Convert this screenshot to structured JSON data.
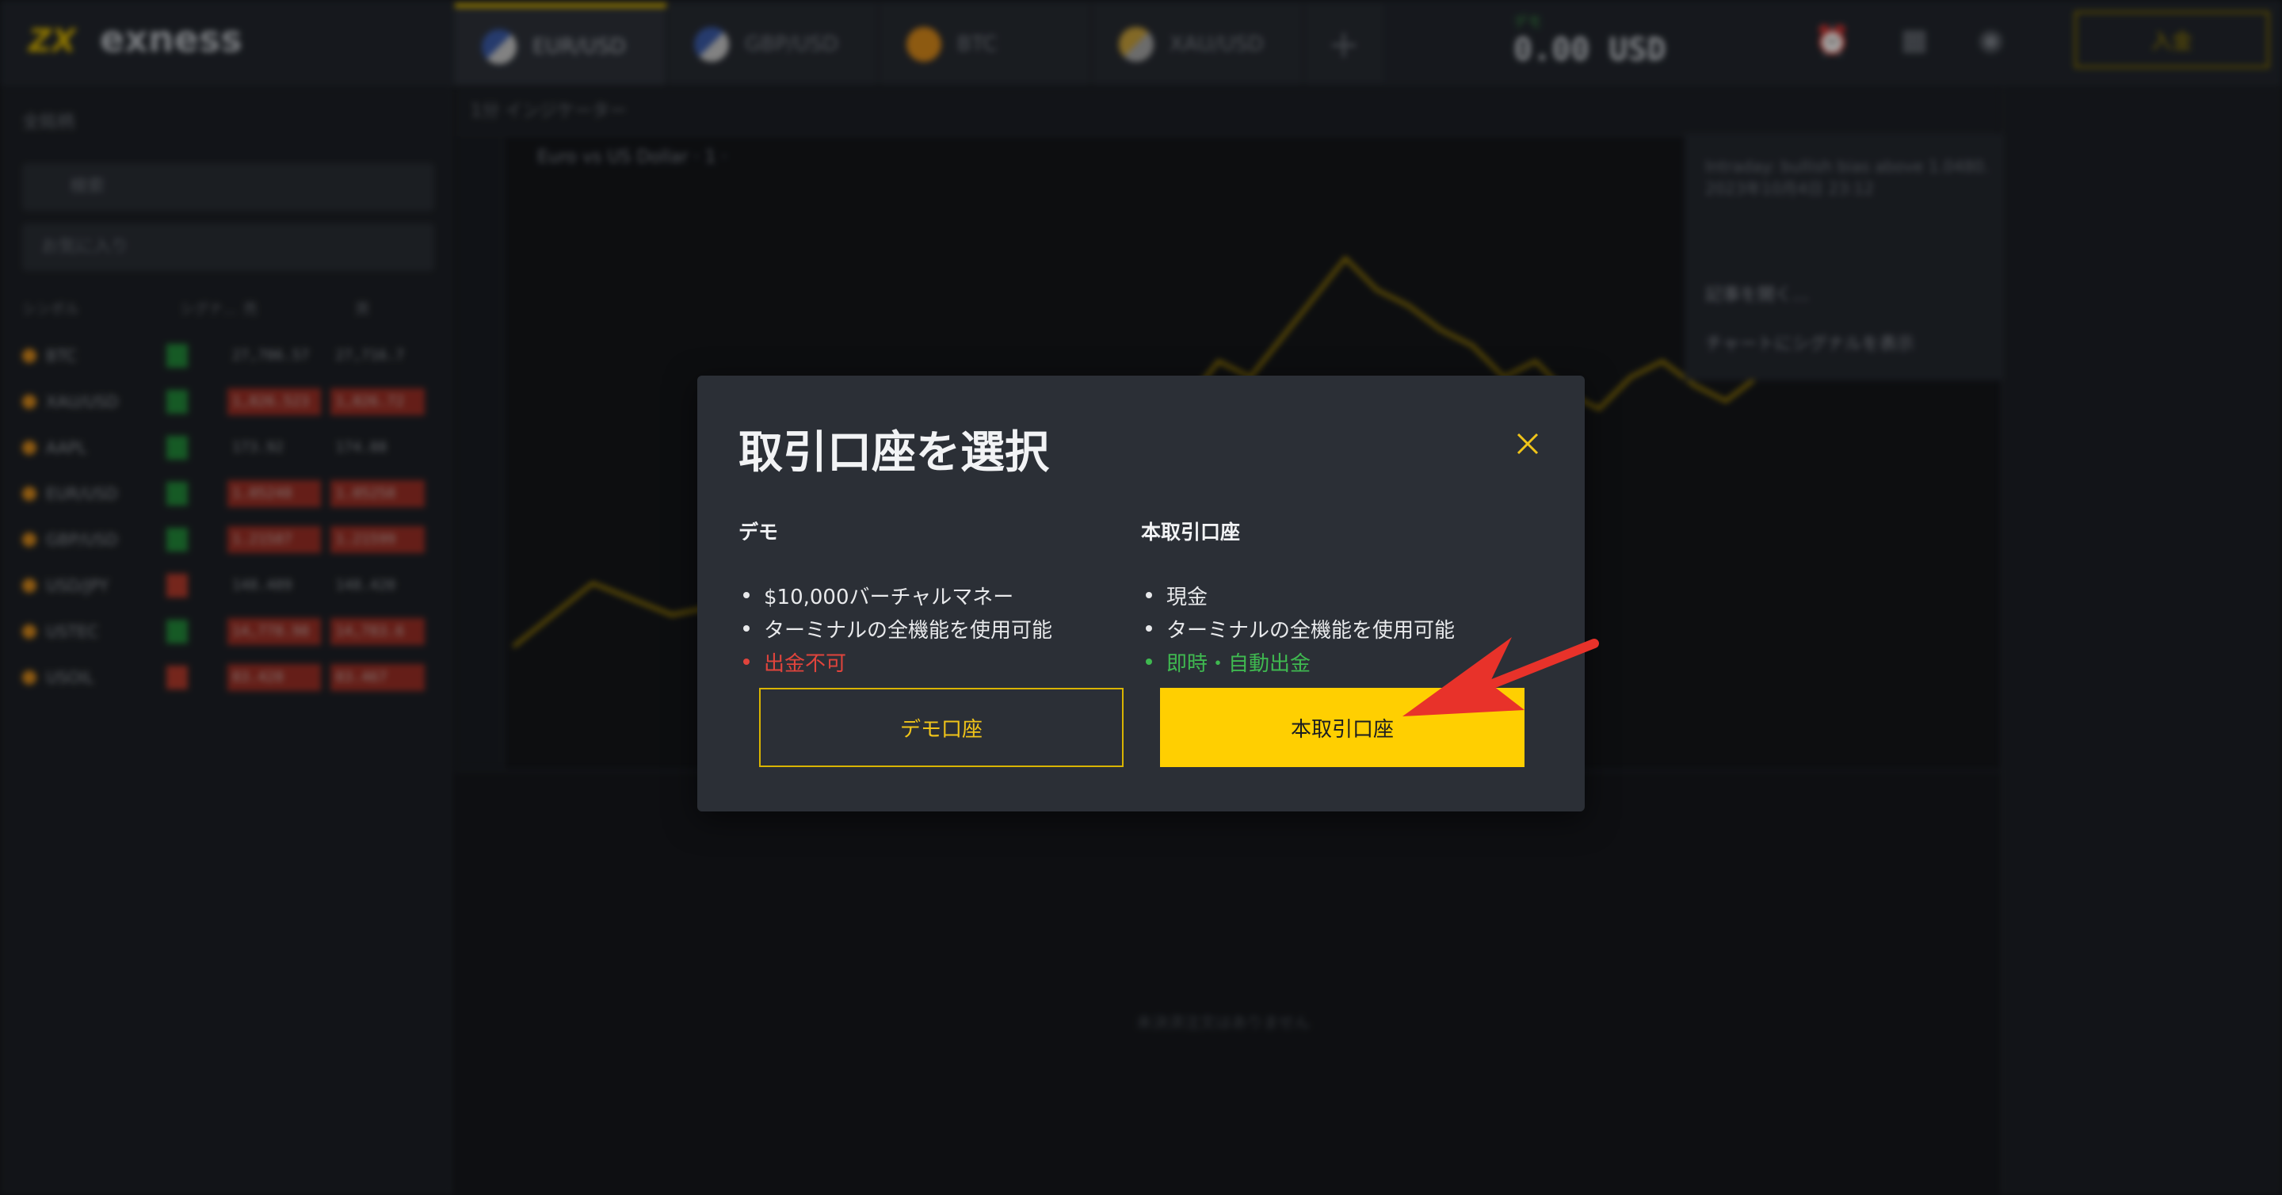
{
  "app": {
    "logo_text": "exness",
    "tabs": [
      {
        "label": "EUR/USD",
        "active": true
      },
      {
        "label": "GBP/USD",
        "active": false
      },
      {
        "label": "BTC",
        "active": false
      },
      {
        "label": "XAU/USD",
        "active": false
      }
    ],
    "tab_add": "+",
    "balance_label": "デモ",
    "balance_value": "0.00 USD",
    "deposit_label": "入金",
    "left_panel": {
      "header": "全銘柄",
      "search_placeholder": "検索",
      "filter_label": "お気に入り",
      "columns": [
        "シンボル",
        "シグナ...",
        "売",
        "買"
      ],
      "rows": [
        {
          "symbol": "BTC",
          "dir": "up",
          "bid": "27,706.57",
          "ask": "27,716.7",
          "red": false
        },
        {
          "symbol": "XAU/USD",
          "dir": "up",
          "bid": "1,826.523",
          "ask": "1,826.72",
          "red": true
        },
        {
          "symbol": "AAPL",
          "dir": "up",
          "bid": "173.92",
          "ask": "174.08",
          "red": false
        },
        {
          "symbol": "EUR/USD",
          "dir": "up",
          "bid": "1.05248",
          "ask": "1.05258",
          "red": true
        },
        {
          "symbol": "GBP/USD",
          "dir": "up",
          "bid": "1.21587",
          "ask": "1.21599",
          "red": true
        },
        {
          "symbol": "USD/JPY",
          "dir": "down",
          "bid": "148.409",
          "ask": "148.420",
          "red": false
        },
        {
          "symbol": "USTEC",
          "dir": "up",
          "bid": "14,778.98",
          "ask": "14,783.6",
          "red": true
        },
        {
          "symbol": "USOIL",
          "dir": "down",
          "bid": "83.428",
          "ask": "83.467",
          "red": true
        }
      ]
    },
    "chart": {
      "toolbar_text": "1分   インジケーター",
      "title": "Euro vs US Dollar · 1 ·",
      "empty_message": "未決済注文はありません"
    },
    "popover": {
      "headline": "Intraday: bullish bias above 1.0480.",
      "timestamp": "2023年10月4日 23:12",
      "open_article": "記事を開く...",
      "show_signals": "チャートにシグナルを表示"
    }
  },
  "modal": {
    "title": "取引口座を選択",
    "demo": {
      "heading": "デモ",
      "features": [
        {
          "text": "$10,000バーチャルマネー",
          "kind": "normal"
        },
        {
          "text": "ターミナルの全機能を使用可能",
          "kind": "normal"
        },
        {
          "text": "出金不可",
          "kind": "warn"
        }
      ],
      "button_label": "デモ口座"
    },
    "real": {
      "heading": "本取引口座",
      "features": [
        {
          "text": "現金",
          "kind": "normal"
        },
        {
          "text": "ターミナルの全機能を使用可能",
          "kind": "normal"
        },
        {
          "text": "即時・自動出金",
          "kind": "ok"
        }
      ],
      "button_label": "本取引口座"
    }
  },
  "colors": {
    "accent": "#ffcf01",
    "warn": "#e0443c",
    "ok": "#3fb950",
    "arrow": "#e8322a"
  }
}
